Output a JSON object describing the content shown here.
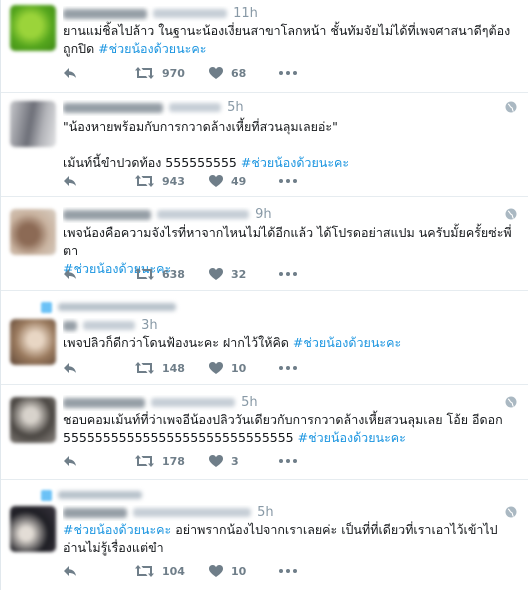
{
  "icons": {
    "reply": "reply-arrow-icon",
    "retweet": "retweet-arrows-icon",
    "like": "heart-icon",
    "more": "more-dots-icon",
    "globe": "globe-icon"
  },
  "colors": {
    "hashtag": "#1b95e0",
    "action_grey": "#6f7e89",
    "border": "#e6ecf0"
  },
  "hashtag": "#ช่วยน้องด้วยนะคะ",
  "tweets": [
    {
      "time": "11h",
      "text_before": "ยานแม่ชิ้ลไปล้าว ในฐานะน้องเงี่ยนสาขาโลกหน้า ชั้นทัมจัยไม่ได้ที่เพจศาสนาดีๆต้องถูกปิด ",
      "text_after": "",
      "retweets": "970",
      "likes": "68"
    },
    {
      "time": "5h",
      "text_before": "\"น้องหายพร้อมกับการกวาดล้างเหี้ยที่สวนลุมเลยอ่ะ\"\n\nเม้นท์นี้ขำปวดท้อง 555555555 ",
      "text_after": "",
      "retweets": "943",
      "likes": "49"
    },
    {
      "time": "9h",
      "text_before": "เพจน้องคือความจังไรที่หาจากไหนไม่ได้อีกแล้ว ได้โปรดอย่าสแปม นครับมั้ยครั้ยซ่ะพี่ตา\n",
      "text_after": "",
      "retweets": "638",
      "likes": "32"
    },
    {
      "time": "3h",
      "text_before": "เพจปลิวก็ดีกว่าโดนฟ้องนะคะ ฝากไว้ให้คิด ",
      "text_after": "",
      "retweets": "148",
      "likes": "10"
    },
    {
      "time": "5h",
      "text_before": "ชอบคอมเม้นท์ที่ว่าเพจอีน้องปลิววันเดียวกับการกวาดล้างเหี้ยสวนลุมเลย โอ้ย อีดอก 55555555555555555555555555555 ",
      "text_after": "",
      "retweets": "178",
      "likes": "3"
    },
    {
      "time": "5h",
      "text_before": "",
      "text_after": " อย่าพรากน้องไปจากเราเลยค่ะ เป็นที่ที่เดียวที่เราเอาไว้เข้าไปอ่านไม่รู้เรื่องแต่ขำ",
      "retweets": "104",
      "likes": "10"
    }
  ]
}
